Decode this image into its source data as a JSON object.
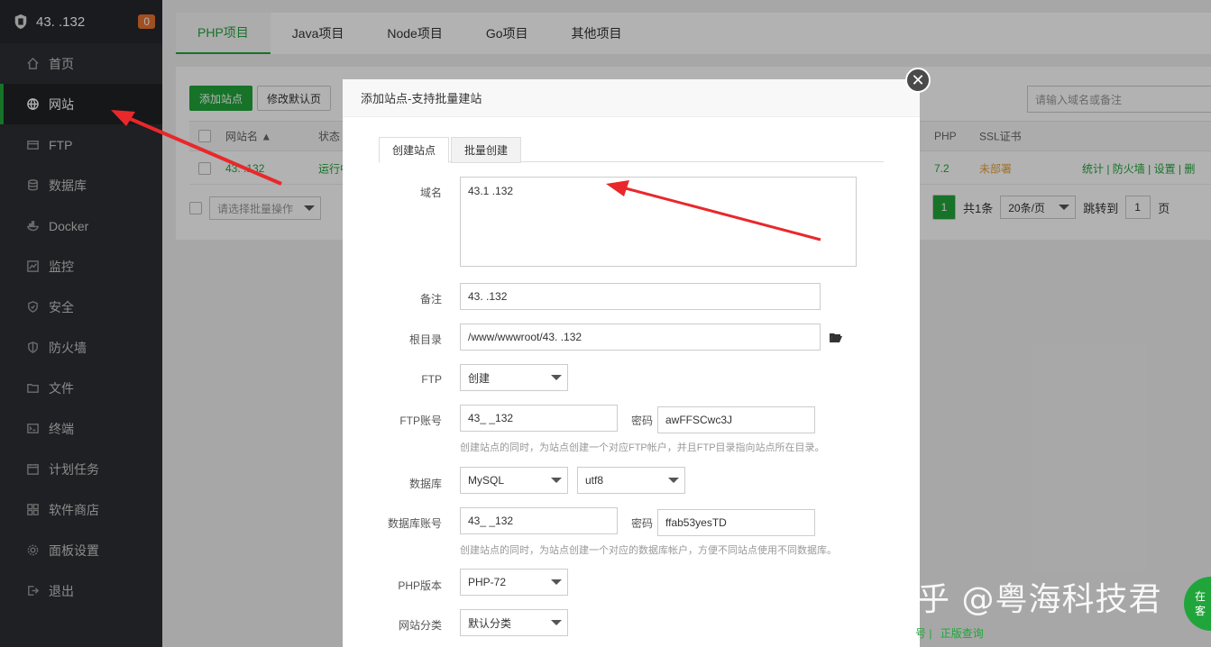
{
  "sidebar": {
    "server_ip": "43.           .132",
    "badge": "0",
    "items": [
      {
        "label": "首页",
        "icon": "home-icon"
      },
      {
        "label": "网站",
        "icon": "globe-icon",
        "active": true
      },
      {
        "label": "FTP",
        "icon": "ftp-icon"
      },
      {
        "label": "数据库",
        "icon": "database-icon"
      },
      {
        "label": "Docker",
        "icon": "docker-icon"
      },
      {
        "label": "监控",
        "icon": "monitor-icon"
      },
      {
        "label": "安全",
        "icon": "shield-icon"
      },
      {
        "label": "防火墙",
        "icon": "firewall-icon"
      },
      {
        "label": "文件",
        "icon": "folder-icon"
      },
      {
        "label": "终端",
        "icon": "terminal-icon"
      },
      {
        "label": "计划任务",
        "icon": "calendar-icon"
      },
      {
        "label": "软件商店",
        "icon": "apps-icon"
      },
      {
        "label": "面板设置",
        "icon": "gear-icon"
      },
      {
        "label": "退出",
        "icon": "logout-icon"
      }
    ]
  },
  "project_tabs": [
    "PHP项目",
    "Java项目",
    "Node项目",
    "Go项目",
    "其他项目"
  ],
  "toolbar": {
    "add_site": "添加站点",
    "modify_default": "修改默认页"
  },
  "search": {
    "placeholder": "请输入域名或备注"
  },
  "table": {
    "headers": {
      "name": "网站名 ▲",
      "status": "状态",
      "php": "PHP",
      "ssl": "SSL证书"
    },
    "row": {
      "name": "43.           .132",
      "status": "运行中",
      "php": "7.2",
      "ssl": "未部署",
      "actions": "统计 | 防火墙 | 设置 | 删"
    }
  },
  "batch": {
    "placeholder": "请选择批量操作"
  },
  "pagination": {
    "page": "1",
    "total": "共1条",
    "per_page": "20条/页",
    "goto": "跳转到",
    "goto_value": "1",
    "page_unit": "页"
  },
  "modal": {
    "title": "添加站点-支持批量建站",
    "tabs": [
      "创建站点",
      "批量创建"
    ],
    "domain": {
      "label": "域名",
      "value": "43.1          .132"
    },
    "remark": {
      "label": "备注",
      "value": "43.          .132"
    },
    "root": {
      "label": "根目录",
      "value": "/www/wwwroot/43.          .132"
    },
    "ftp": {
      "label": "FTP",
      "value": "创建"
    },
    "ftp_account": {
      "label": "FTP账号",
      "user": "43_          _132",
      "pwd_label": "密码",
      "pwd": "awFFSCwc3J"
    },
    "ftp_hint": "创建站点的同时，为站点创建一个对应FTP帐户，并且FTP目录指向站点所在目录。",
    "database": {
      "label": "数据库",
      "type": "MySQL",
      "charset": "utf8"
    },
    "db_account": {
      "label": "数据库账号",
      "user": "43_          _132",
      "pwd_label": "密码",
      "pwd": "ffab53yesTD"
    },
    "db_hint": "创建站点的同时，为站点创建一个对应的数据库帐户，方便不同站点使用不同数据库。",
    "php_version": {
      "label": "PHP版本",
      "value": "PHP-72"
    },
    "site_category": {
      "label": "网站分类",
      "value": "默认分类"
    }
  },
  "watermark": "知乎 @粤海科技君",
  "corner_badge": "在\n客",
  "footer": {
    "separator": "号 |",
    "link": "正版查询"
  },
  "colors": {
    "accent": "#20a53a",
    "arrow": "#e8282b",
    "sidebar": "#2c2f33"
  }
}
